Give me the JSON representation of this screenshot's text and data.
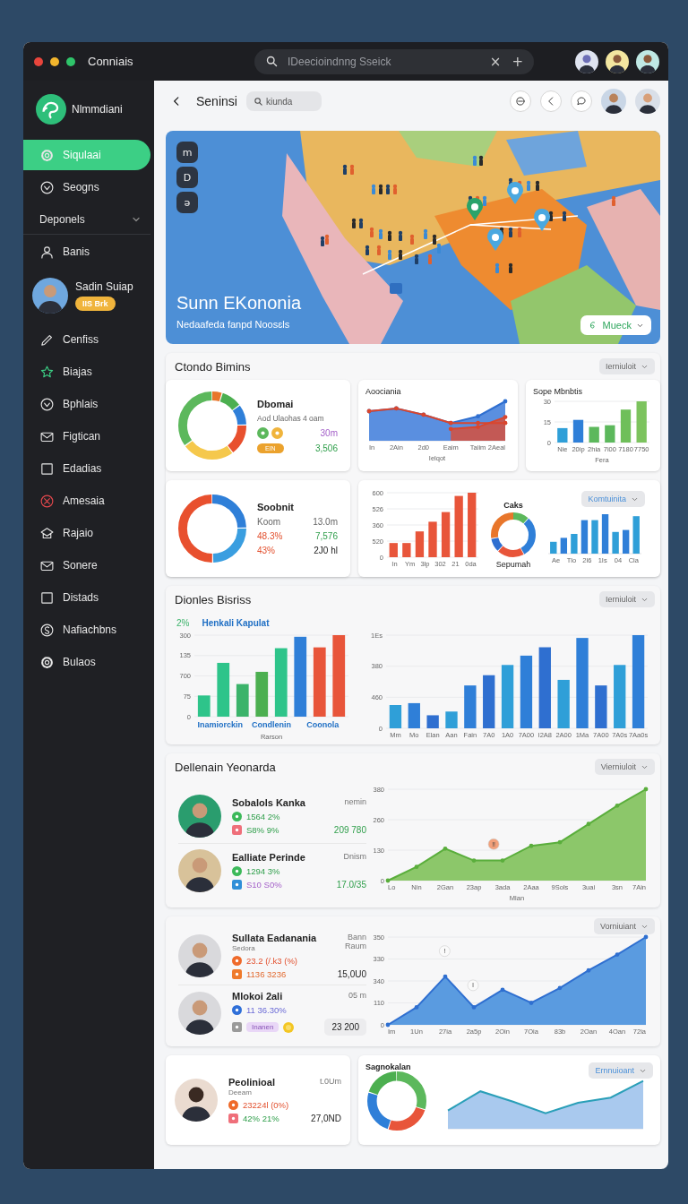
{
  "window": {
    "title": "Conniais",
    "search": {
      "placeholder": "IDeecioindnng Sseick"
    },
    "clear": "×",
    "add": "+"
  },
  "sidebar": {
    "brand": "Nlmmdiani",
    "items": [
      {
        "kind": "nav",
        "label": "Siqulaai",
        "selected": true,
        "alert": false
      },
      {
        "kind": "nav",
        "label": "Seogns",
        "selected": false,
        "alert": false
      },
      {
        "kind": "section",
        "label": "Deponels"
      },
      {
        "kind": "nav",
        "label": "Banis",
        "selected": false,
        "alert": false
      },
      {
        "kind": "profile",
        "name": "Sadin Suiap",
        "badge": "IIS Brk"
      },
      {
        "kind": "nav",
        "label": "Cenfiss",
        "selected": false,
        "alert": false
      },
      {
        "kind": "nav",
        "label": "Biajas",
        "selected": false,
        "alert": false
      },
      {
        "kind": "nav",
        "label": "Bphlais",
        "selected": false,
        "alert": false
      },
      {
        "kind": "nav",
        "label": "Figtican",
        "selected": false,
        "alert": false
      },
      {
        "kind": "nav",
        "label": "Edadias",
        "selected": false,
        "alert": false
      },
      {
        "kind": "nav",
        "label": "Amesaia",
        "selected": false,
        "alert": true
      },
      {
        "kind": "nav",
        "label": "Rajaio",
        "selected": false,
        "alert": false
      },
      {
        "kind": "nav",
        "label": "Sonere",
        "selected": false,
        "alert": false
      },
      {
        "kind": "nav",
        "label": "Distads",
        "selected": false,
        "alert": false
      },
      {
        "kind": "nav",
        "label": "Nafiachbns",
        "selected": false,
        "alert": false
      },
      {
        "kind": "nav",
        "label": "Bulaos",
        "selected": false,
        "alert": false
      }
    ]
  },
  "header": {
    "title": "Seninsi",
    "search": {
      "placeholder": "kiunda"
    }
  },
  "banner": {
    "title": "Sunn EKononia",
    "subtitle": "Nedaafeda fanpd Noosɛls",
    "tools": [
      "m",
      "D",
      "ə"
    ],
    "dropdown": "Mueck"
  },
  "panels": [
    {
      "kind": "grid",
      "title": "Ctondo Bimins",
      "dropdown": "Ierniuloit",
      "cards": [
        {
          "kind": "donut-stats",
          "title": "Dbomai",
          "subtitle": "Aod Ulaohas 4 oam",
          "rows": [
            {
              "kind": "dots",
              "value": "30m"
            },
            {
              "kind": "pill",
              "label": "EIN",
              "value": "3,506"
            }
          ]
        },
        {
          "kind": "area",
          "title": "Aoociania",
          "xlabels": [
            "In",
            "2Ain",
            "2d0",
            "Eaim",
            "Taiim",
            "2Aeal"
          ],
          "xtitle": "Ielqot"
        },
        {
          "kind": "bars",
          "title": "Sope Mbnbtis",
          "ylabels": [
            "30",
            "15",
            "0"
          ],
          "xlabels": [
            "Nie",
            "20ip",
            "2hia",
            "7i00",
            "7180",
            "7750"
          ],
          "xtitle": "Fera"
        },
        {
          "kind": "donut-stats",
          "title": "Soobnit",
          "rows": [
            {
              "kind": "muted",
              "label": "Koom",
              "value": "13.0m"
            },
            {
              "kind": "delta",
              "label": "48.3%",
              "value": "7,576"
            },
            {
              "kind": "share",
              "label": "43%",
              "value": "2J0 hl"
            }
          ]
        },
        {
          "kind": "combo",
          "ylabels": [
            "600",
            "526",
            "360",
            "520",
            "0"
          ],
          "xlabels": [
            "In",
            "Ym",
            "3lp",
            "302",
            "21",
            "0da"
          ],
          "donut_title": "Caks",
          "donut_caption": "Sepumah",
          "dropdown": "Komtuinita",
          "xlabels2": [
            "Ae",
            "Tlo",
            "2l6",
            "1Is",
            "04",
            "Cia"
          ]
        }
      ]
    },
    {
      "kind": "bars-pair",
      "title": "Dionles Bisriss",
      "dropdown": "Ierniuloit",
      "legend_value": "2%",
      "legend_label": "Henkali Kapulat",
      "left": {
        "ylabels": [
          "300",
          "135",
          "700",
          "75",
          "0"
        ],
        "xlabels": [
          "Inamiorckin",
          "Condlenin",
          "Coonola"
        ],
        "xtitle": "Rarson"
      },
      "right": {
        "ylabels": [
          "1Es",
          "380",
          "460",
          "0"
        ],
        "xlabels": [
          "Mm",
          "Mo",
          "Elan",
          "Aan",
          "Fain",
          "7A0",
          "1A0",
          "7A00",
          "I2A8",
          "2A00",
          "1Ma",
          "7A00",
          "7A0s",
          "7Aa0s"
        ]
      }
    },
    {
      "kind": "people-chart",
      "title": "Dellenain Yeonarda",
      "dropdown": "Vierniuloit",
      "people": [
        {
          "kind": "gain",
          "name": "Sobalols Kanka",
          "notes": [
            "nemin"
          ],
          "stats": [
            {
              "kind": "gain",
              "text": "1564 2%"
            },
            {
              "kind": "flag",
              "text": "S8% 9%"
            }
          ],
          "value": "209 780"
        },
        {
          "kind": "gain",
          "name": "Ealliate Perinde",
          "notes": [
            "Dnism"
          ],
          "stats": [
            {
              "kind": "gain",
              "text": "1294 3%"
            },
            {
              "kind": "note",
              "text": "S10 S0%"
            }
          ],
          "value": "17.0/35"
        }
      ],
      "chart": {
        "ylabels": [
          "380",
          "260",
          "130",
          "0"
        ],
        "xlabels": [
          "Lo",
          "Nin",
          "2Gan",
          "23ap",
          "3ada",
          "2Aaa",
          "9Sols",
          "3uai",
          "3sn",
          "7Ain"
        ],
        "xtitle": "Mlan",
        "markers": [
          "!!"
        ]
      }
    },
    {
      "kind": "people-chart",
      "dropdown": "Vorniuiant",
      "people": [
        {
          "kind": "plain",
          "name": "Sullata Eadanania",
          "subtitle": "Sedora",
          "notes": [
            "Bann",
            "Raum"
          ],
          "stats": [
            {
              "kind": "loss",
              "text": "23.2 (/.k3 (%)"
            },
            {
              "kind": "alert",
              "text": "1136 3236"
            }
          ],
          "value": "15,0U0"
        },
        {
          "kind": "boxed",
          "name": "Mlokoi 2ali",
          "notes": [
            "05 m"
          ],
          "stats": [
            {
              "kind": "mark",
              "text": "11 36.30%"
            },
            {
              "kind": "chip",
              "text": "Inanen"
            }
          ],
          "value": "23 200"
        }
      ],
      "chart": {
        "ylabels": [
          "350",
          "330",
          "340",
          "110",
          "0"
        ],
        "xlabels": [
          "Im",
          "1Un",
          "27ia",
          "2a5p",
          "2Oin",
          "7Oia",
          "83b",
          "2Oan",
          "4Oan",
          "72ia"
        ],
        "markers": [
          "!",
          "l"
        ]
      }
    },
    {
      "kind": "row",
      "cards": [
        {
          "kind": "person-card",
          "person": {
            "kind": "plain",
            "name": "Peolinioal",
            "subtitle": "Deeam",
            "notes": [
              "t.0Um"
            ],
            "stats": [
              {
                "kind": "loss",
                "text": "23224l (0%)"
              },
              {
                "kind": "flag",
                "text": "42% 21%"
              }
            ],
            "value": "27,0ND"
          }
        },
        {
          "kind": "donut-area",
          "title": "Sagnokalan",
          "dropdown": "Ernnuioant"
        }
      ]
    }
  ]
}
